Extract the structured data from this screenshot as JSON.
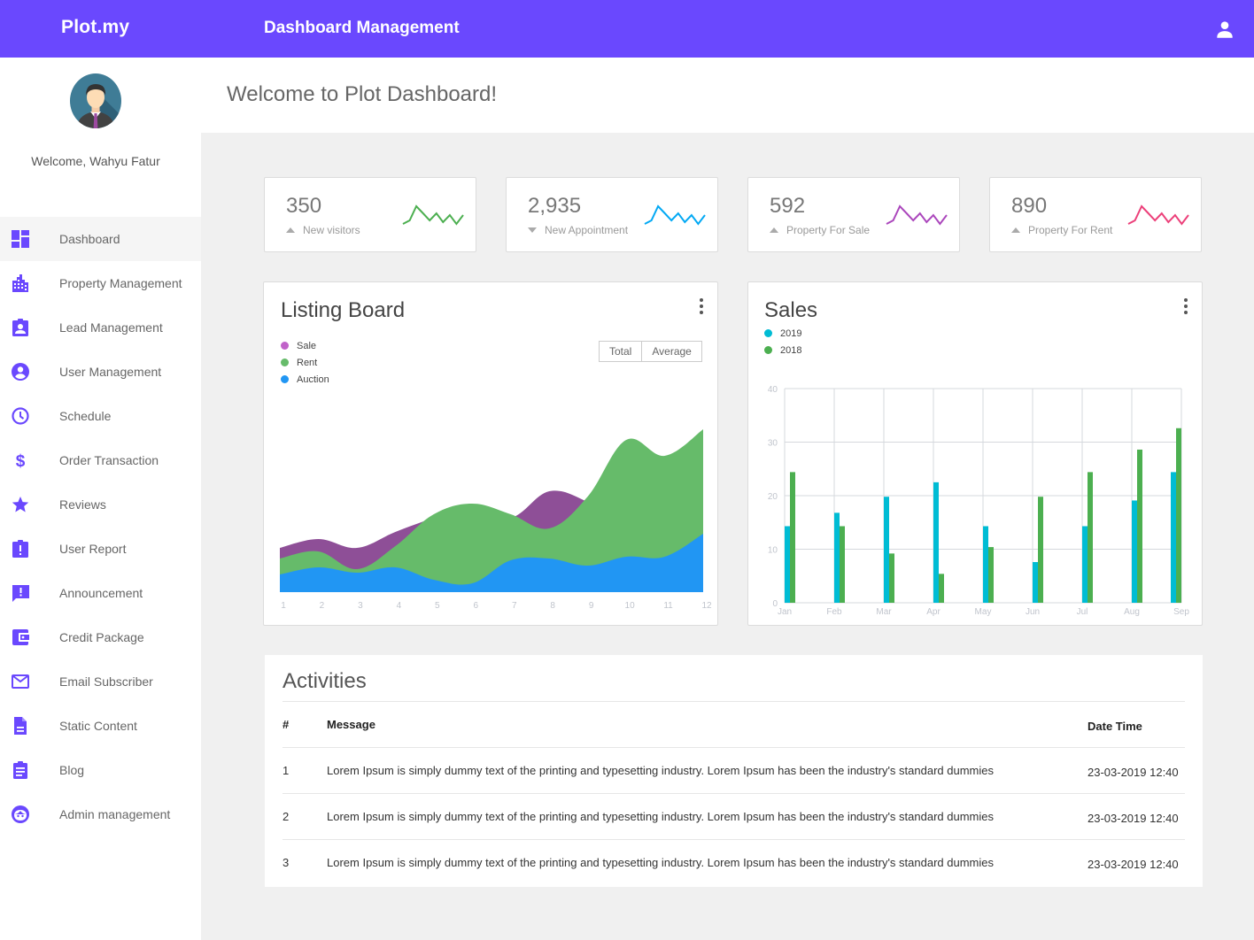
{
  "app": {
    "brand": "Plot.my",
    "header_title": "Dashboard Management",
    "accent_color": "#6a48fe"
  },
  "sidebar": {
    "welcome": "Welcome, Wahyu Fatur",
    "items": [
      {
        "label": "Dashboard",
        "icon": "dashboard-icon",
        "active": true
      },
      {
        "label": "Property Management",
        "icon": "building-icon"
      },
      {
        "label": "Lead Management",
        "icon": "contact-badge-icon"
      },
      {
        "label": "User Management",
        "icon": "account-circle-icon"
      },
      {
        "label": "Schedule",
        "icon": "clock-icon"
      },
      {
        "label": "Order Transaction",
        "icon": "dollar-icon"
      },
      {
        "label": "Reviews",
        "icon": "star-icon"
      },
      {
        "label": "User Report",
        "icon": "report-icon"
      },
      {
        "label": "Announcement",
        "icon": "feedback-icon"
      },
      {
        "label": "Credit Package",
        "icon": "wallet-icon"
      },
      {
        "label": "Email Subscriber",
        "icon": "mail-icon"
      },
      {
        "label": "Static Content",
        "icon": "document-icon"
      },
      {
        "label": "Blog",
        "icon": "clipboard-icon"
      },
      {
        "label": "Admin management",
        "icon": "face-icon"
      }
    ]
  },
  "main": {
    "welcome_title": "Welcome to Plot Dashboard!"
  },
  "stats": [
    {
      "value": "350",
      "label": "New visitors",
      "trend": "up",
      "color": "#4caf50",
      "spark": [
        2,
        4,
        12,
        8,
        4,
        8,
        3,
        7,
        2,
        7
      ]
    },
    {
      "value": "2,935",
      "label": "New Appointment",
      "trend": "down",
      "color": "#03a9f4",
      "spark": [
        2,
        4,
        12,
        8,
        4,
        8,
        3,
        7,
        2,
        7
      ]
    },
    {
      "value": "592",
      "label": "Property For Sale",
      "trend": "up",
      "color": "#ab47bc",
      "spark": [
        2,
        4,
        12,
        8,
        4,
        8,
        3,
        7,
        2,
        7
      ]
    },
    {
      "value": "890",
      "label": "Property For Rent",
      "trend": "up",
      "color": "#ec407a",
      "spark": [
        2,
        4,
        12,
        8,
        4,
        8,
        3,
        7,
        2,
        7
      ]
    }
  ],
  "listing": {
    "title": "Listing Board",
    "toggle": {
      "total": "Total",
      "average": "Average"
    }
  },
  "sales": {
    "title": "Sales"
  },
  "chart_data": [
    {
      "type": "area",
      "title": "Listing Board",
      "x": [
        1,
        2,
        3,
        4,
        5,
        6,
        7,
        8,
        9,
        10,
        11,
        12
      ],
      "xlabel": "",
      "ylabel": "",
      "grid": false,
      "legend": "top-left",
      "ylim": [
        0,
        100
      ],
      "series": [
        {
          "name": "Sale",
          "color": "#8e4f97",
          "legend_color": "#c063c9",
          "values": [
            25,
            30,
            25,
            34,
            42,
            49,
            42,
            57,
            51,
            39,
            24,
            19
          ]
        },
        {
          "name": "Rent",
          "color": "#66bb6a",
          "legend_color": "#66bb6a",
          "values": [
            19,
            23,
            13,
            26,
            44,
            50,
            44,
            36,
            54,
            86,
            77,
            92
          ]
        },
        {
          "name": "Auction",
          "color": "#2196f3",
          "legend_color": "#2196f3",
          "values": [
            10,
            14,
            11,
            14,
            7,
            5,
            18,
            19,
            15,
            20,
            20,
            33
          ]
        }
      ]
    },
    {
      "type": "bar",
      "title": "Sales",
      "categories": [
        "Jan",
        "Feb",
        "Mar",
        "Apr",
        "May",
        "Jun",
        "Jul",
        "Aug",
        "Sep"
      ],
      "xlabel": "",
      "ylabel": "",
      "ylim": [
        0,
        40
      ],
      "yticks": [
        0,
        10,
        20,
        30,
        40
      ],
      "grid": true,
      "legend": "top-left",
      "series": [
        {
          "name": "2019",
          "color": "#00bcd4",
          "values": [
            14.3,
            16.8,
            19.8,
            22.5,
            14.3,
            7.6,
            14.3,
            19.1,
            24.4
          ]
        },
        {
          "name": "2018",
          "color": "#4caf50",
          "values": [
            24.4,
            14.3,
            9.2,
            5.4,
            10.4,
            19.8,
            24.4,
            28.6,
            32.6
          ]
        }
      ]
    }
  ],
  "activities": {
    "title": "Activities",
    "columns": [
      "#",
      "Message",
      "Date Time"
    ],
    "rows": [
      {
        "num": "1",
        "message": "Lorem Ipsum is simply dummy text of the printing and typesetting industry. Lorem Ipsum has been the industry's standard dummies",
        "datetime": "23-03-2019 12:40"
      },
      {
        "num": "2",
        "message": "Lorem Ipsum is simply dummy text of the printing and typesetting industry. Lorem Ipsum has been the industry's standard dummies",
        "datetime": "23-03-2019 12:40"
      },
      {
        "num": "3",
        "message": "Lorem Ipsum is simply dummy text of the printing and typesetting industry. Lorem Ipsum has been the industry's standard dummies",
        "datetime": "23-03-2019 12:40"
      }
    ]
  }
}
